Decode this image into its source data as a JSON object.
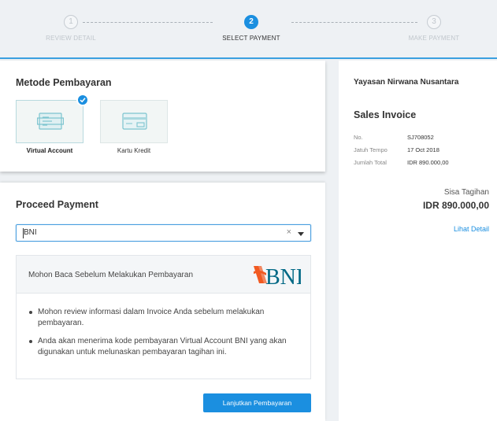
{
  "stepper": {
    "steps": [
      {
        "num": "1",
        "label": "REVIEW DETAIL",
        "state": "done"
      },
      {
        "num": "2",
        "label": "SELECT PAYMENT",
        "state": "active"
      },
      {
        "num": "3",
        "label": "MAKE PAYMENT",
        "state": "todo"
      }
    ]
  },
  "payment_method": {
    "title": "Metode Pembayaran",
    "options": [
      {
        "label": "Virtual Account",
        "icon": "virtual-account-icon",
        "selected": true
      },
      {
        "label": "Kartu Kredit",
        "icon": "credit-card-icon",
        "selected": false
      }
    ]
  },
  "proceed": {
    "title": "Proceed Payment",
    "bank_select": {
      "value": "BNI",
      "clear": "×"
    },
    "info_header": "Mohon Baca Sebelum Melakukan Pembayaran",
    "bank_logo_text": "BNI",
    "notes": [
      "Mohon review informasi dalam Invoice Anda sebelum melakukan pembayaran.",
      "Anda akan menerima kode pembayaran Virtual Account BNI yang akan digunakan untuk melunaskan pembayaran tagihan ini."
    ],
    "button": "Lanjutkan Pembayaran"
  },
  "invoice": {
    "org": "Yayasan Nirwana Nusantara",
    "title": "Sales Invoice",
    "fields": [
      {
        "key": "No.",
        "value": "SJ708052"
      },
      {
        "key": "Jatuh Tempo",
        "value": "17 Oct 2018"
      },
      {
        "key": "Jumlah Total",
        "value": "IDR 890.000,00"
      }
    ],
    "balance_label": "Sisa Tagihan",
    "balance_value": "IDR 890.000,00",
    "detail_link": "Lihat Detail"
  },
  "colors": {
    "accent": "#1b8fe0",
    "bni_orange": "#f15a22",
    "bni_teal": "#006885"
  }
}
